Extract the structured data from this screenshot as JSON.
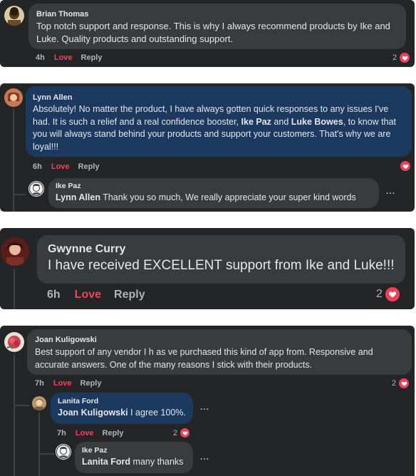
{
  "comments": [
    {
      "author": "Brian Thomas",
      "text": "Top notch support and response. This is why I always recommend products by Ike and Luke. Quality products and outstanding support.",
      "time": "4h",
      "love": "Love",
      "reply": "Reply",
      "reaction_count": "2"
    },
    {
      "author": "Lynn Allen",
      "text_parts": [
        "Absolutely! No matter the product, I have always gotten quick responses to any issues I've had. It is such a relief and a real confidence booster, ",
        "Ike Paz",
        " and ",
        "Luke Bowes",
        ", to know that you will always stand behind your products and support your customers. That's why we are loyal!!!"
      ],
      "time": "6h",
      "love": "Love",
      "reply": "Reply",
      "reply_comment": {
        "author": "Ike Paz",
        "mention": "Lynn Allen",
        "text": " Thank you so much, We really appreciate your super kind words",
        "more": "..."
      }
    },
    {
      "author": "Gwynne Curry",
      "text": "I have received EXCELLENT support from Ike and Luke!!!",
      "time": "6h",
      "love": "Love",
      "reply": "Reply",
      "reaction_count": "2"
    },
    {
      "author": "Joan Kuligowski",
      "text": "Best support of any vendor I h as ve purchased this kind of app from. Responsive and accurate answers. One of the many reasons I stick with their products.",
      "time": "7h",
      "love": "Love",
      "reply": "Reply",
      "reaction_count": "2",
      "reply_comment": {
        "author": "Lanita Ford",
        "mention": "Joan Kuligowski",
        "text": " I agree 100%.",
        "time": "7h",
        "love": "Love",
        "reply": "Reply",
        "reaction_count": "2",
        "more": "...",
        "nested_reply": {
          "author": "Ike Paz",
          "mention": "Lanita Ford",
          "text": " many thanks",
          "more": "..."
        }
      }
    }
  ],
  "colors": {
    "card_bg": "#242526",
    "bubble": "#3a3b3c",
    "bubble_highlight": "#1c3a60",
    "love": "#f3425f",
    "heart": "#f33e58"
  },
  "icons": [
    "heart-icon",
    "more-options-icon"
  ]
}
